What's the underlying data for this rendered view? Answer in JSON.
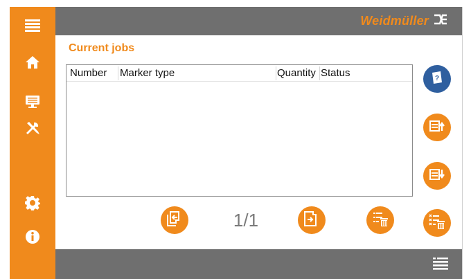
{
  "brand": {
    "name": "Weidmüller",
    "color": "#f08a1c"
  },
  "page": {
    "title": "Current jobs"
  },
  "table": {
    "columns": [
      "Number",
      "Marker type",
      "Quantity",
      "Status"
    ],
    "rows": []
  },
  "pager": {
    "text": "1/1"
  },
  "sidebar": {
    "items": [
      {
        "icon": "menu-icon"
      },
      {
        "icon": "home-icon"
      },
      {
        "icon": "monitor-icon"
      },
      {
        "icon": "tools-icon"
      },
      {
        "icon": "settings-gear-icon"
      },
      {
        "icon": "info-icon"
      }
    ]
  },
  "actions": {
    "help": {
      "icon": "help-book-icon",
      "color": "#2f5f9f"
    },
    "move_up": {
      "icon": "list-up-icon"
    },
    "move_down": {
      "icon": "list-down-icon"
    },
    "prev_page": {
      "icon": "page-back-icon"
    },
    "next_page": {
      "icon": "page-forward-icon"
    },
    "delete_job": {
      "icon": "delete-list-icon"
    },
    "delete_all": {
      "icon": "delete-all-icon"
    }
  },
  "footer": {
    "icon": "job-list-icon"
  },
  "colors": {
    "accent": "#f08a1c",
    "bar": "#6f6f6f"
  }
}
